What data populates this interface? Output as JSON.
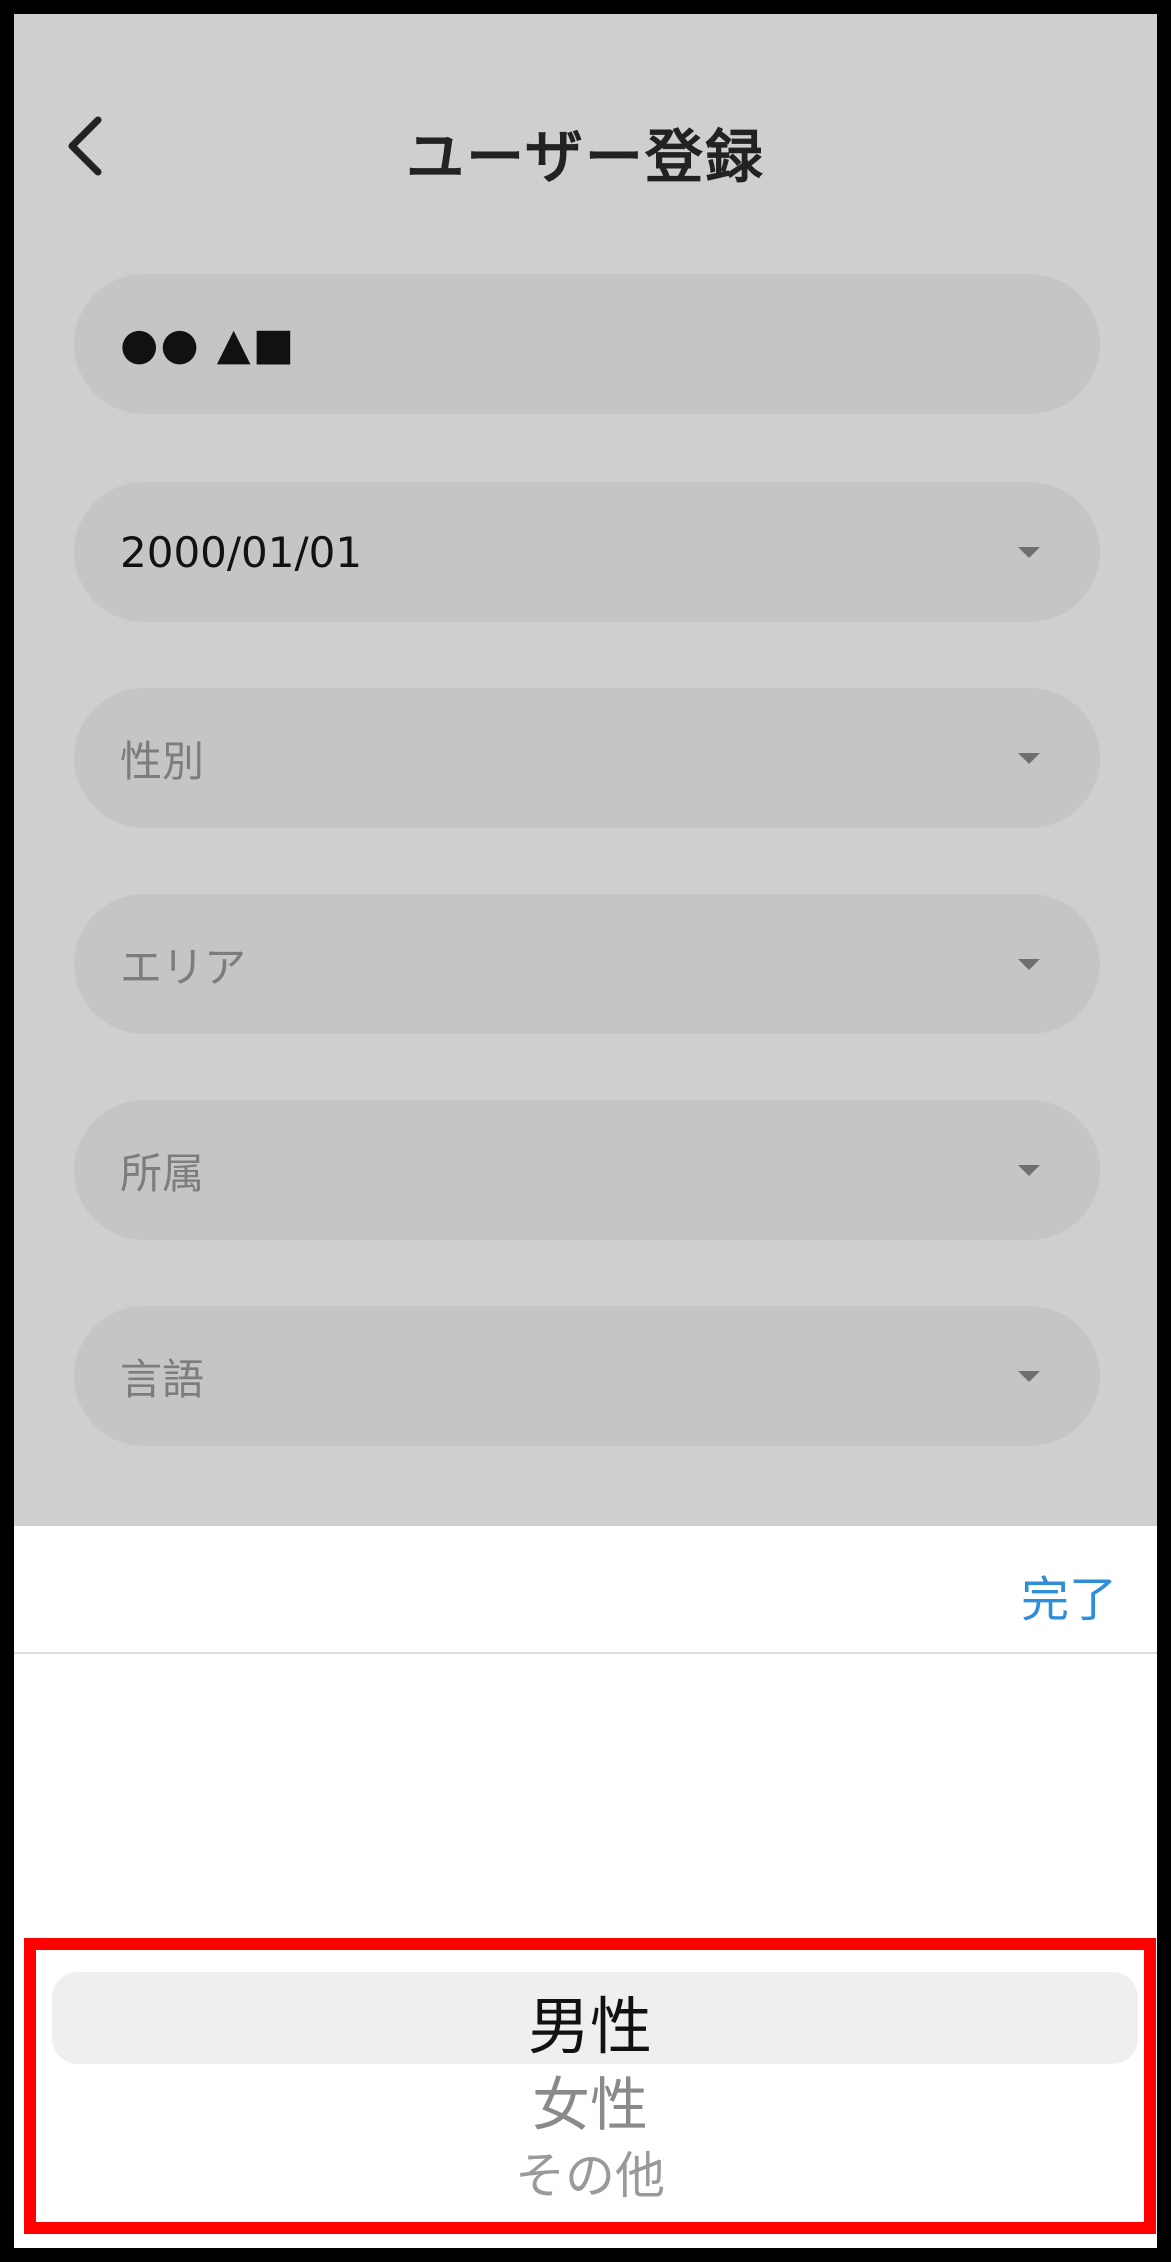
{
  "header": {
    "title": "ユーザー登録",
    "back_icon": "chevron-left-icon"
  },
  "form": {
    "name": {
      "value": "●● ▲■"
    },
    "birthdate": {
      "value": "2000/01/01"
    },
    "gender": {
      "placeholder": "性別"
    },
    "area": {
      "placeholder": "エリア"
    },
    "affiliation": {
      "placeholder": "所属"
    },
    "language": {
      "placeholder": "言語"
    },
    "dropdown_icon": "caret-down-icon"
  },
  "picker": {
    "done_label": "完了",
    "options": [
      "男性",
      "女性",
      "その他"
    ],
    "selected_index": 0
  },
  "colors": {
    "accent": "#2e8fd8",
    "highlight_border": "#ff0000"
  }
}
